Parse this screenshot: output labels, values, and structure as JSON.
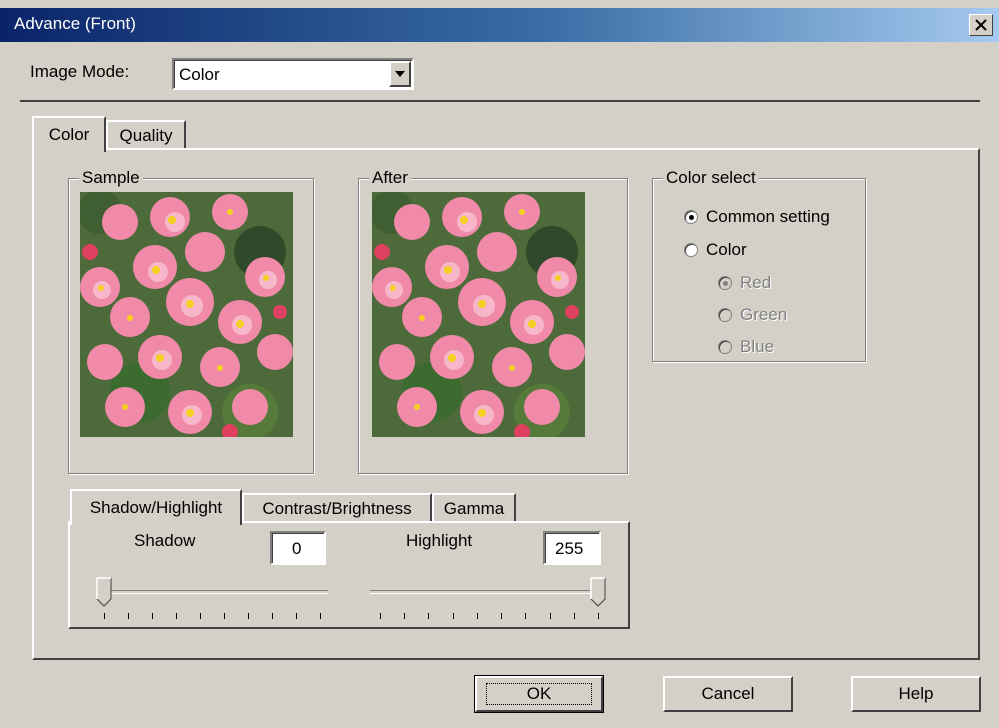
{
  "window": {
    "title": "Advance (Front)",
    "close_glyph": "×"
  },
  "image_mode": {
    "label": "Image Mode:",
    "label_mnemonic": "I",
    "value": "Color"
  },
  "main_tabs": [
    {
      "label": "Color",
      "active": true
    },
    {
      "label": "Quality",
      "active": false
    }
  ],
  "sample": {
    "label": "Sample"
  },
  "after": {
    "label": "After"
  },
  "color_select": {
    "label": "Color select",
    "options": [
      {
        "label": "Common setting",
        "checked": true,
        "disabled": false
      },
      {
        "label": "Color",
        "checked": false,
        "disabled": false
      },
      {
        "label": "Red",
        "checked": true,
        "disabled": true
      },
      {
        "label": "Green",
        "checked": false,
        "disabled": true
      },
      {
        "label": "Blue",
        "checked": false,
        "disabled": true
      }
    ]
  },
  "sub_tabs": [
    {
      "label": "Shadow/Highlight",
      "active": true
    },
    {
      "label": "Contrast/Brightness",
      "active": false
    },
    {
      "label": "Gamma",
      "active": false
    }
  ],
  "shadow": {
    "label": "Shadow",
    "value": "0",
    "level": 0
  },
  "highlight": {
    "label": "Highlight",
    "value": "255",
    "level": 255
  },
  "buttons": {
    "ok": "OK",
    "cancel": "Cancel",
    "help": "Help"
  },
  "colors": {
    "title_start": "#0a246a",
    "title_end": "#a6caf0",
    "face": "#d4d0c8"
  },
  "icons": {
    "close": "close-icon",
    "dropdown": "chevron-down-icon"
  }
}
